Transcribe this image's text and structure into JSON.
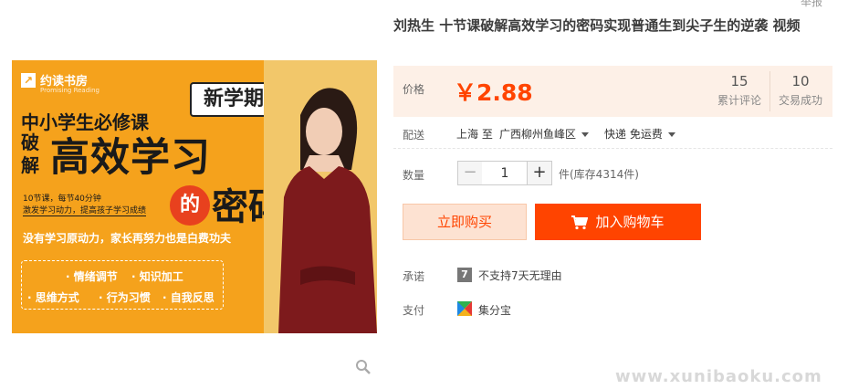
{
  "top_link": "举报",
  "image": {
    "brand_name": "约读书房",
    "brand_sub": "Promising Reading",
    "badge": "新学期",
    "subtitle": "中小学生必修课",
    "pojie": "破解",
    "headline": "高效学习",
    "de": "的",
    "mima": "密码",
    "meta_line1": "10节课，每节40分钟",
    "meta_line2": "激发学习动力，提高孩子学习成绩",
    "slogan": "没有学习原动力，家长再努力也是白费功夫",
    "features": [
      "· 情绪调节",
      "· 知识加工",
      "· 思维方式",
      "· 行为习惯",
      "· 自我反思"
    ]
  },
  "product": {
    "title": "刘热生 十节课破解高效学习的密码实现普通生到尖子生的逆袭 视频"
  },
  "price": {
    "label": "价格",
    "value": "￥2.88",
    "reviews_count": "15",
    "reviews_label": "累计评论",
    "sold_count": "10",
    "sold_label": "交易成功"
  },
  "shipping": {
    "label": "配送",
    "from": "上海 至",
    "to": "广西柳州鱼峰区",
    "method": "快递 免运费"
  },
  "quantity": {
    "label": "数量",
    "minus": "−",
    "value": "1",
    "plus": "+",
    "stock": "件(库存4314件)"
  },
  "actions": {
    "buy_now": "立即购买",
    "add_to_cart": "加入购物车"
  },
  "promise": {
    "label": "承诺",
    "icon_char": "7",
    "text": "不支持7天无理由"
  },
  "payment": {
    "label": "支付",
    "text": "集分宝"
  },
  "watermark": "www.xunibaoku.com",
  "colors": {
    "accent": "#ff4400",
    "price_bg": "#fdf0e7",
    "image_bg": "#f5a21c",
    "buy_bg": "#fde2d2"
  }
}
